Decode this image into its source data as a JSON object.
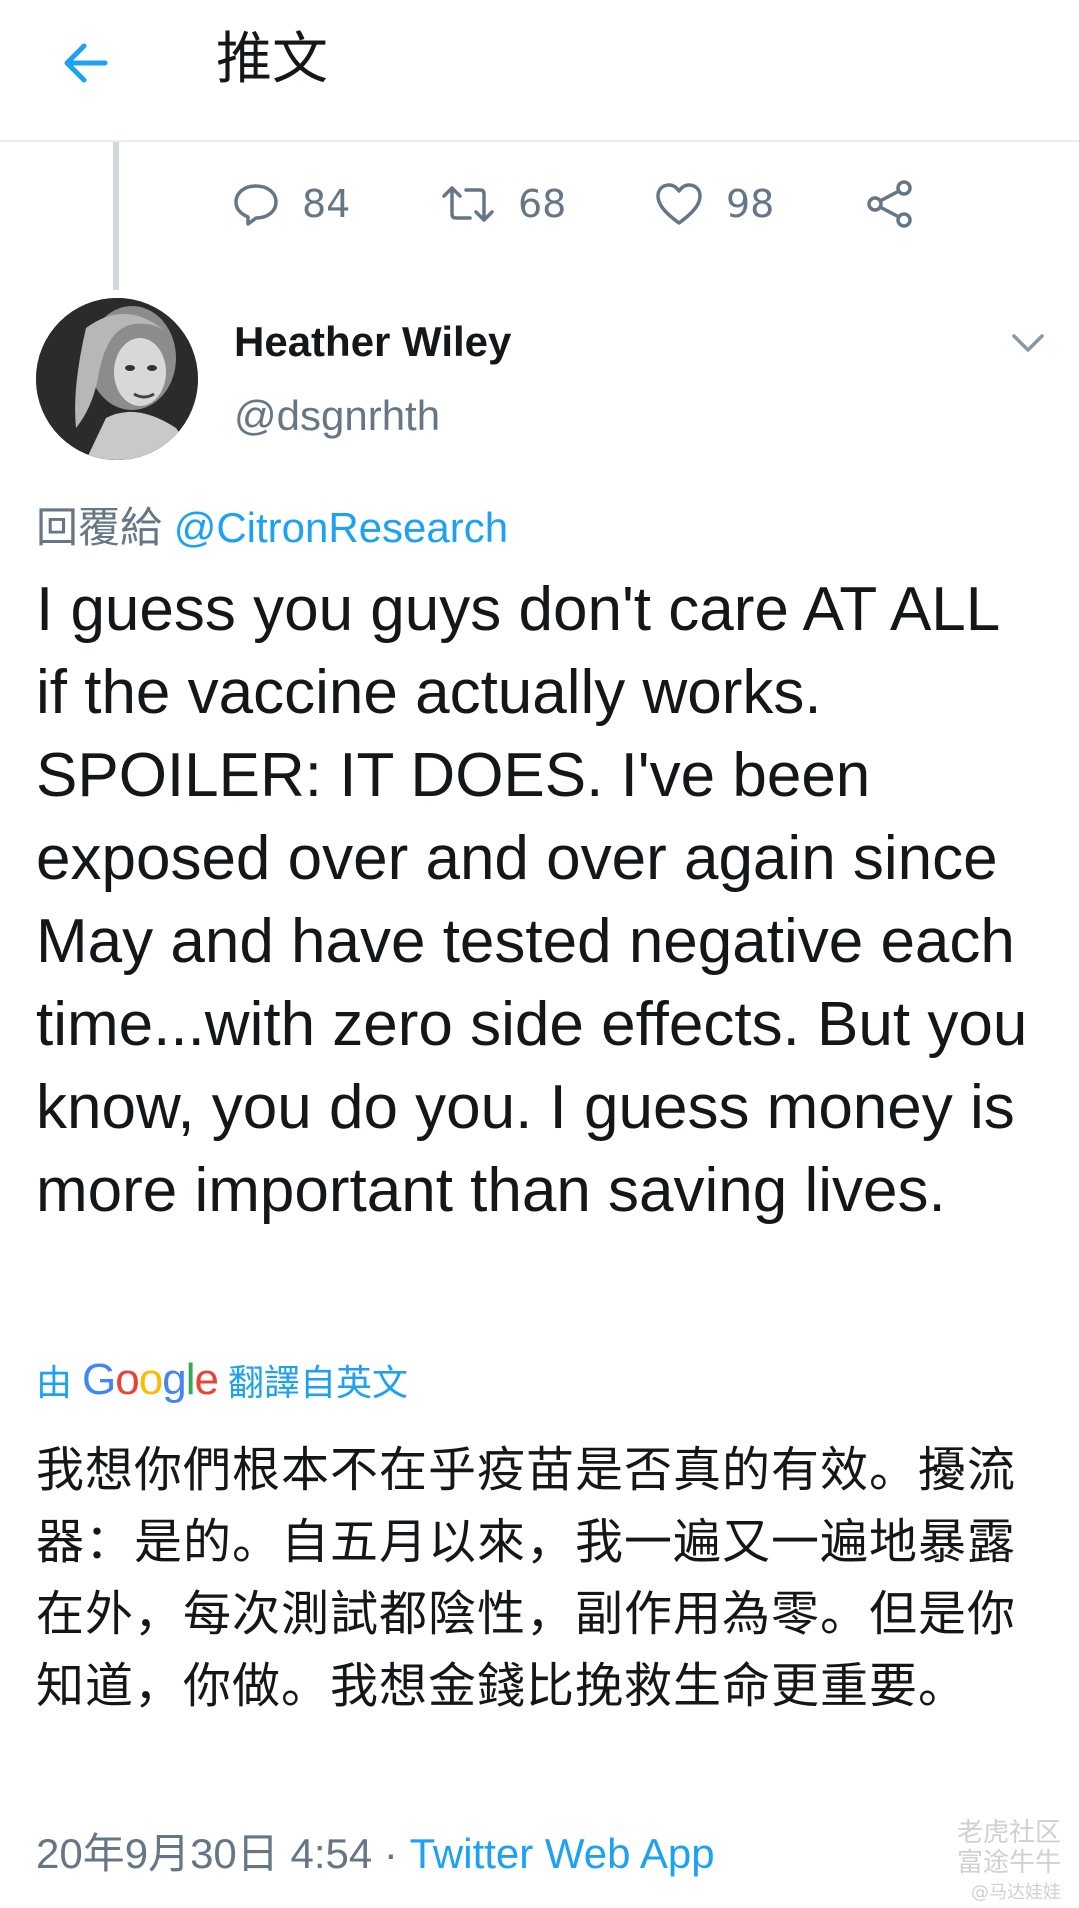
{
  "header": {
    "title": "推文",
    "back_icon": "arrow-left-icon"
  },
  "actions": {
    "reply_count": "84",
    "retweet_count": "68",
    "like_count": "98"
  },
  "tweet": {
    "display_name": "Heather Wiley",
    "handle": "@dsgnrhth",
    "reply_prefix": "回覆給",
    "reply_mention": "@CitronResearch",
    "text": "I guess you guys don't care AT ALL if the vaccine actually works. SPOILER: IT DOES. I've been exposed over and over again since May and have tested negative each time...with zero side effects. But you know, you do you. I guess money is more important than saving lives.",
    "translate_prefix": "由",
    "translate_suffix": "翻譯自英文",
    "translated_text": "我想你們根本不在乎疫苗是否真的有效。擾流器：是的。自五月以來，我一遍又一遍地暴露在外，每次測試都陰性，副作用為零。但是你知道，你做。我想金錢比挽救生命更重要。",
    "timestamp": "20年9月30日 4:54",
    "separator": "·",
    "source": "Twitter Web App"
  },
  "google_logo": [
    "G",
    "o",
    "o",
    "g",
    "l",
    "e"
  ],
  "watermark": {
    "line1": "老虎社区",
    "line2": "富途牛牛",
    "line3": "@马达娃娃"
  },
  "colors": {
    "accent": "#1da1f2",
    "muted": "#657786",
    "text": "#14171a"
  }
}
